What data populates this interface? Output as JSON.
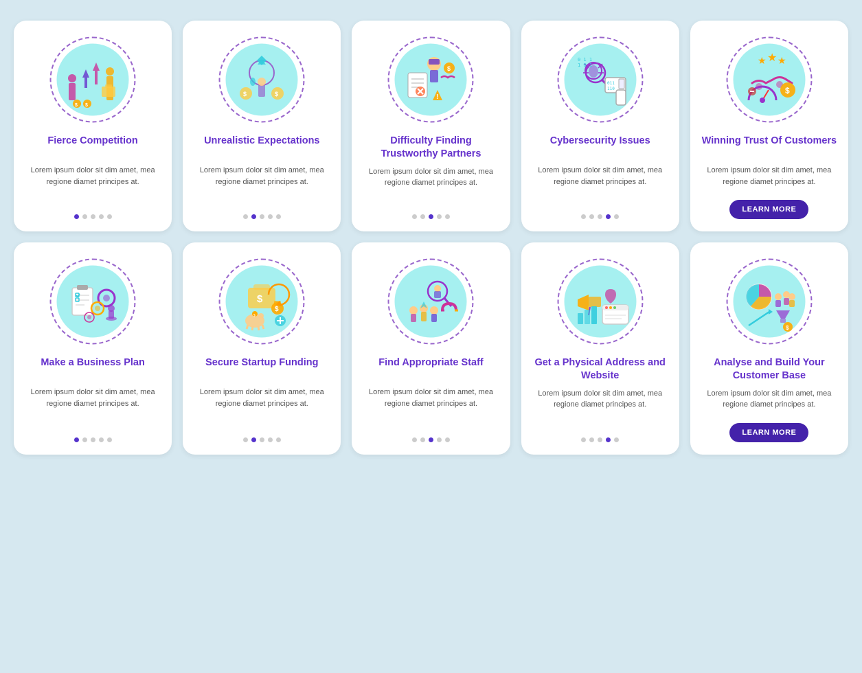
{
  "cards": [
    {
      "id": "fierce-competition",
      "title": "Fierce Competition",
      "title_color": "purple",
      "body": "Lorem ipsum dolor sit dim amet, mea regione diamet principes at.",
      "active_dot": 0,
      "show_button": false,
      "icon_color": "#cc3399"
    },
    {
      "id": "unrealistic-expectations",
      "title": "Unrealistic Expectations",
      "title_color": "purple",
      "body": "Lorem ipsum dolor sit dim amet, mea regione diamet principes at.",
      "active_dot": 1,
      "show_button": false,
      "icon_color": "#cc6600"
    },
    {
      "id": "difficulty-finding",
      "title": "Difficulty Finding Trustworthy Partners",
      "title_color": "purple",
      "body": "Lorem ipsum dolor sit dim amet, mea regione diamet principes at.",
      "active_dot": 2,
      "show_button": false,
      "icon_color": "#ff6633"
    },
    {
      "id": "cybersecurity-issues",
      "title": "Cybersecurity Issues",
      "title_color": "purple",
      "body": "Lorem ipsum dolor sit dim amet, mea regione diamet principes at.",
      "active_dot": 3,
      "show_button": false,
      "icon_color": "#9933cc"
    },
    {
      "id": "winning-trust",
      "title": "Winning Trust Of Customers",
      "title_color": "purple",
      "body": "Lorem ipsum dolor sit dim amet, mea regione diamet principes at.",
      "active_dot": 4,
      "show_button": true,
      "icon_color": "#ffaa00"
    },
    {
      "id": "business-plan",
      "title": "Make a Business Plan",
      "title_color": "purple",
      "body": "Lorem ipsum dolor sit dim amet, mea regione diamet principes at.",
      "active_dot": 0,
      "show_button": false,
      "icon_color": "#6633cc"
    },
    {
      "id": "startup-funding",
      "title": "Secure Startup Funding",
      "title_color": "purple",
      "body": "Lorem ipsum dolor sit dim amet, mea regione diamet principes at.",
      "active_dot": 1,
      "show_button": false,
      "icon_color": "#ff9900"
    },
    {
      "id": "find-staff",
      "title": "Find Appropriate Staff",
      "title_color": "purple",
      "body": "Lorem ipsum dolor sit dim amet, mea regione diamet principes at.",
      "active_dot": 2,
      "show_button": false,
      "icon_color": "#cc3399"
    },
    {
      "id": "physical-address",
      "title": "Get a Physical Address and Website",
      "title_color": "purple",
      "body": "Lorem ipsum dolor sit dim amet, mea regione diamet principes at.",
      "active_dot": 3,
      "show_button": false,
      "icon_color": "#ff6600"
    },
    {
      "id": "analyse-build",
      "title": "Analyse and Build Your Customer Base",
      "title_color": "purple",
      "body": "Lorem ipsum dolor sit dim amet, mea regione diamet principes at.",
      "active_dot": 4,
      "show_button": true,
      "icon_color": "#cc3366"
    }
  ],
  "learn_more_label": "LEARN MORE"
}
